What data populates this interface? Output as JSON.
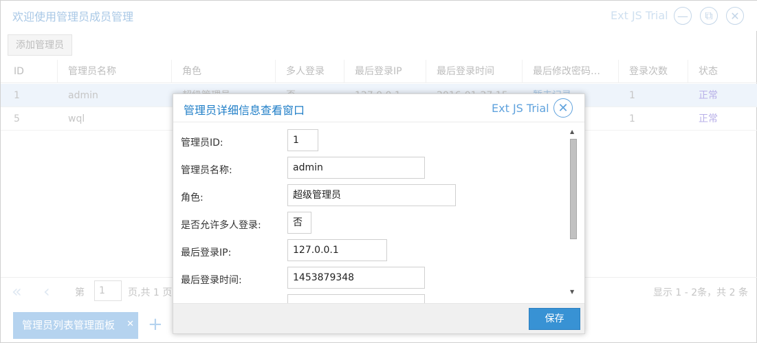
{
  "main": {
    "title": "欢迎使用管理员成员管理",
    "trial": "Ext JS Trial",
    "add_button": "添加管理员",
    "columns": [
      "ID",
      "管理员名称",
      "角色",
      "多人登录",
      "最后登录IP",
      "最后登录时间",
      "最后修改密码…",
      "登录次数",
      "状态"
    ],
    "rows": [
      {
        "id": "1",
        "name": "admin",
        "role": "超级管理员",
        "multi": "否",
        "ip": "127.0.0.1",
        "time": "2016-01-27 15",
        "pwd": "暂未记录",
        "count": "1",
        "status": "正常"
      },
      {
        "id": "5",
        "name": "wql",
        "role": "",
        "multi": "",
        "ip": "",
        "time": "",
        "pwd": "",
        "count": "1",
        "status": "正常"
      }
    ],
    "pager": {
      "page_label": "第",
      "page_value": "1",
      "page_suffix": "页,共 1 页",
      "info": "显示 1 - 2条，共 2 条"
    }
  },
  "tabs": [
    {
      "label": "管理员列表管理面板"
    }
  ],
  "window": {
    "title": "管理员详细信息查看窗口",
    "trial": "Ext JS Trial",
    "fields": [
      {
        "label": "管理员ID:",
        "value": "1"
      },
      {
        "label": "管理员名称:",
        "value": "admin"
      },
      {
        "label": "角色:",
        "value": "超级管理员"
      },
      {
        "label": "是否允许多人登录:",
        "value": "否"
      },
      {
        "label": "最后登录IP:",
        "value": "127.0.0.1"
      },
      {
        "label": "最后登录时间:",
        "value": "1453879348"
      },
      {
        "label": "",
        "value": ""
      }
    ],
    "save_button": "保存"
  },
  "colors": {
    "accent": "#3892d4",
    "title_blue": "#1f7ec7",
    "status_purple": "#b8b0e8"
  }
}
